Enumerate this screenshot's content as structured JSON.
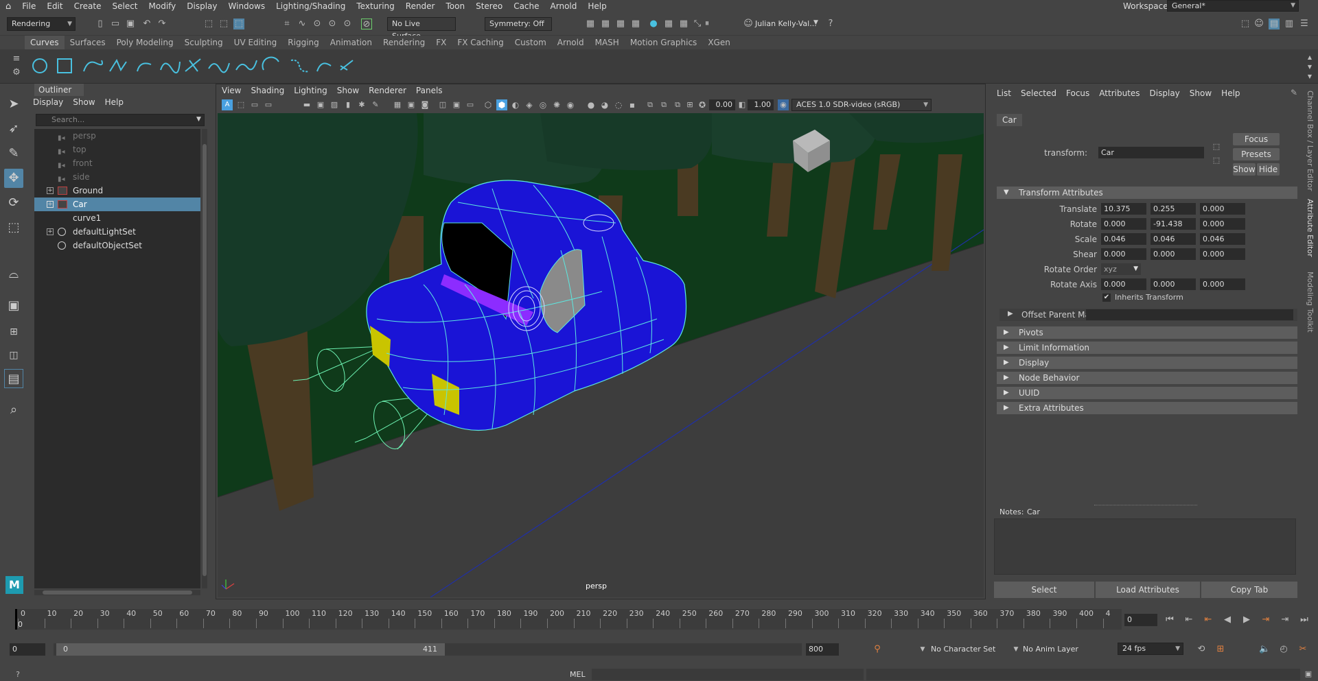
{
  "menubar": {
    "items": [
      "File",
      "Edit",
      "Create",
      "Select",
      "Modify",
      "Display",
      "Windows",
      "Lighting/Shading",
      "Texturing",
      "Render",
      "Toon",
      "Stereo",
      "Cache",
      "Arnold",
      "Help"
    ],
    "workspace_label": "Workspace:",
    "workspace_value": "General*"
  },
  "status": {
    "menuset": "Rendering",
    "live_surface": "No Live Surface",
    "symmetry": "Symmetry: Off",
    "user": "Julian Kelly-Val..."
  },
  "shelf": {
    "tabs": [
      "Curves",
      "Surfaces",
      "Poly Modeling",
      "Sculpting",
      "UV Editing",
      "Rigging",
      "Animation",
      "Rendering",
      "FX",
      "FX Caching",
      "Custom",
      "Arnold",
      "MASH",
      "Motion Graphics",
      "XGen"
    ],
    "active": "Curves"
  },
  "outliner": {
    "title": "Outliner",
    "menu": [
      "Display",
      "Show",
      "Help"
    ],
    "search_placeholder": "Search...",
    "items": [
      {
        "label": "persp",
        "dim": true,
        "icon": "camera-icon"
      },
      {
        "label": "top",
        "dim": true,
        "icon": "camera-icon"
      },
      {
        "label": "front",
        "dim": true,
        "icon": "camera-icon"
      },
      {
        "label": "side",
        "dim": true,
        "icon": "camera-icon"
      },
      {
        "label": "Ground",
        "dim": false,
        "icon": "transform-icon",
        "expand": true
      },
      {
        "label": "Car",
        "dim": false,
        "icon": "transform-icon",
        "expand": true,
        "selected": true
      },
      {
        "label": "curve1",
        "dim": false,
        "icon": "none"
      },
      {
        "label": "defaultLightSet",
        "dim": false,
        "icon": "set-icon",
        "expand": true
      },
      {
        "label": "defaultObjectSet",
        "dim": false,
        "icon": "set-icon"
      }
    ]
  },
  "viewport": {
    "menu": [
      "View",
      "Shading",
      "Lighting",
      "Show",
      "Renderer",
      "Panels"
    ],
    "field1": "0.00",
    "field2": "1.00",
    "colorspace": "ACES 1.0 SDR-video (sRGB)",
    "camera_label": "persp"
  },
  "attribute_editor": {
    "menu": [
      "List",
      "Selected",
      "Focus",
      "Attributes",
      "Display",
      "Show",
      "Help"
    ],
    "tab": "Car",
    "transform_label": "transform:",
    "transform_value": "Car",
    "focus_btn": "Focus",
    "presets_btn": "Presets",
    "show_btn": "Show",
    "hide_btn": "Hide",
    "section_transform": "Transform Attributes",
    "rows": [
      {
        "label": "Translate",
        "values": [
          "10.375",
          "0.255",
          "0.000"
        ]
      },
      {
        "label": "Rotate",
        "values": [
          "0.000",
          "-91.438",
          "0.000"
        ]
      },
      {
        "label": "Scale",
        "values": [
          "0.046",
          "0.046",
          "0.046"
        ]
      },
      {
        "label": "Shear",
        "values": [
          "0.000",
          "0.000",
          "0.000"
        ]
      }
    ],
    "rotate_order_label": "Rotate Order",
    "rotate_order_value": "xyz",
    "rotate_axis_label": "Rotate Axis",
    "rotate_axis_values": [
      "0.000",
      "0.000",
      "0.000"
    ],
    "inherits_label": "Inherits Transform",
    "offset_parent_label": "Offset Parent Matrix",
    "sections": [
      "Pivots",
      "Limit Information",
      "Display",
      "Node Behavior",
      "UUID",
      "Extra Attributes"
    ],
    "notes_label": "Notes:",
    "notes_target": "Car",
    "buttons": [
      "Select",
      "Load Attributes",
      "Copy Tab"
    ]
  },
  "side_tabs": [
    "Channel Box / Layer Editor",
    "Attribute Editor",
    "Modeling Toolkit"
  ],
  "timeslider": {
    "ticks": [
      "0",
      "10",
      "20",
      "30",
      "40",
      "50",
      "60",
      "70",
      "80",
      "90",
      "100",
      "110",
      "120",
      "130",
      "140",
      "150",
      "160",
      "170",
      "180",
      "190",
      "200",
      "210",
      "220",
      "230",
      "240",
      "250",
      "260",
      "270",
      "280",
      "290",
      "300",
      "310",
      "320",
      "330",
      "340",
      "350",
      "360",
      "370",
      "380",
      "390",
      "400",
      "4"
    ],
    "current": "0",
    "current_field": "0"
  },
  "range": {
    "start": "0",
    "inner_start": "0",
    "inner_end": "411",
    "end": "800",
    "character_set": "No Character Set",
    "anim_layer": "No Anim Layer",
    "fps": "24 fps"
  },
  "cmdline": {
    "lang": "MEL"
  },
  "colors": {
    "selection": "#5285a6",
    "car_body": "#1a14d6",
    "wireframe": "#5de8e0",
    "ground": "#0f3a1a",
    "tree_top": "#163a28",
    "tree_trunk": "#4a3a22",
    "headlight": "#c9c400"
  }
}
